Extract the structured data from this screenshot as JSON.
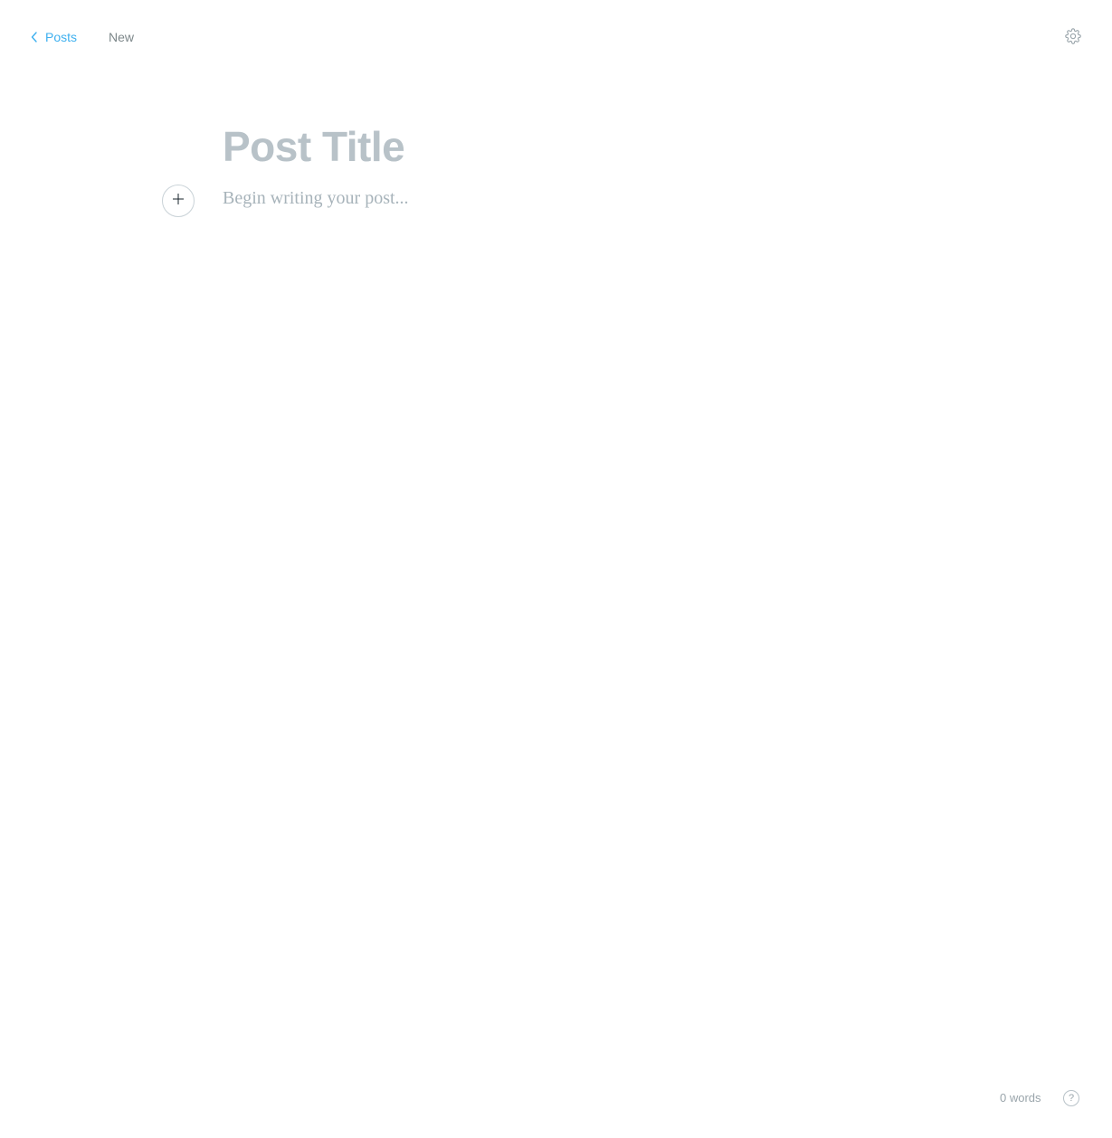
{
  "header": {
    "back_label": "Posts",
    "back_icon": "chevron-left-icon",
    "status": "New",
    "settings_icon": "gear-icon"
  },
  "editor": {
    "title_placeholder": "Post Title",
    "title_value": "",
    "body_placeholder": "Begin writing your post...",
    "add_card_icon": "plus-icon"
  },
  "footer": {
    "word_count": "0 words",
    "help_label": "?"
  },
  "colors": {
    "accent": "#3eb0ef",
    "muted_text": "#7d878a",
    "placeholder": "#b8c2c8"
  }
}
